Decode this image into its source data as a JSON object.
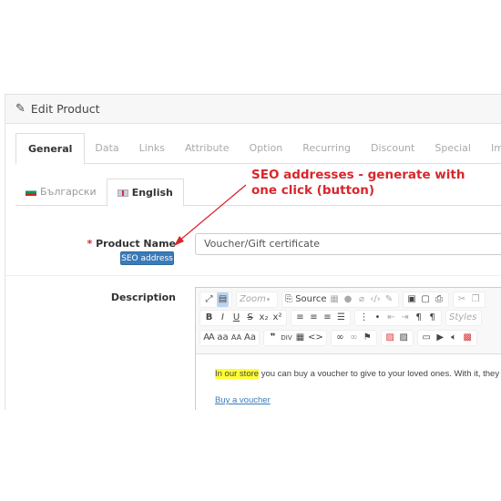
{
  "panel": {
    "title": "Edit Product",
    "icon": "pencil-icon"
  },
  "tabs": [
    {
      "label": "General",
      "active": true
    },
    {
      "label": "Data"
    },
    {
      "label": "Links"
    },
    {
      "label": "Attribute"
    },
    {
      "label": "Option"
    },
    {
      "label": "Recurring"
    },
    {
      "label": "Discount"
    },
    {
      "label": "Special"
    },
    {
      "label": "Image"
    }
  ],
  "languages": [
    {
      "label": "Български",
      "active": false
    },
    {
      "label": "English",
      "active": true
    }
  ],
  "form": {
    "product_name_label": "Product Name",
    "required_mark": "*",
    "product_name_value": "Voucher/Gift certificate",
    "seo_button": "SEO address",
    "description_label": "Description"
  },
  "editor": {
    "zoom_label": "Zoom",
    "source_label": "Source",
    "styles_label": "Styles",
    "content_highlight": "In our store",
    "content_text": " you can buy a voucher to give to your loved ones. With it, they w",
    "link_text": "Buy a voucher"
  },
  "annotation": {
    "text": "SEO addresses - generate with one click (button)",
    "color": "#d9262c"
  },
  "colors": {
    "accent": "#3a7ab8",
    "highlight": "#ffff33"
  }
}
